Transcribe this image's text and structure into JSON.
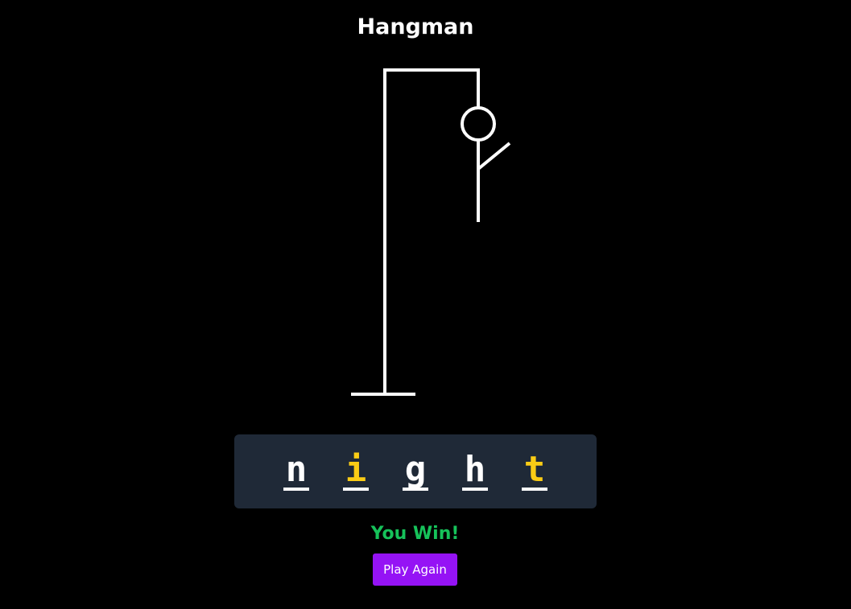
{
  "game": {
    "title": "Hangman",
    "result_text": "You Win!",
    "play_again_label": "Play Again",
    "wrong_guesses_shown": 3,
    "figure_parts_drawn": [
      "head",
      "body",
      "right-arm"
    ]
  },
  "word": {
    "letters": [
      {
        "char": "n",
        "status": "guessed"
      },
      {
        "char": "i",
        "status": "revealed"
      },
      {
        "char": "g",
        "status": "guessed"
      },
      {
        "char": "h",
        "status": "guessed"
      },
      {
        "char": "t",
        "status": "revealed"
      }
    ]
  },
  "colors": {
    "background": "#000000",
    "panel": "#1f2937",
    "letter_guessed": "#ffffff",
    "letter_revealed": "#facc15",
    "result": "#16c25a",
    "button": "#9513f5",
    "drawing": "#ffffff"
  }
}
